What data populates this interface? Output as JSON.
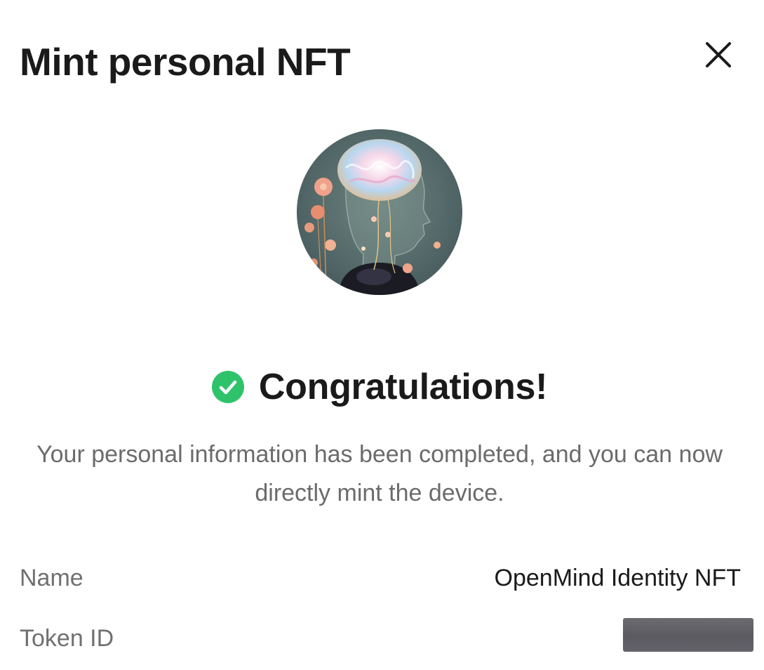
{
  "modal": {
    "title": "Mint personal NFT"
  },
  "icons": {
    "close": "close-icon",
    "success": "check-circle-icon"
  },
  "colors": {
    "success": "#2ec36b",
    "title_text": "#1a1a1a",
    "muted_text": "#6b6b6b",
    "redaction": "#5f5f65"
  },
  "status": {
    "title": "Congratulations!",
    "message": "Your personal information has been completed, and you can now directly mint the device."
  },
  "details": {
    "name_label": "Name",
    "name_value": "OpenMind Identity NFT",
    "token_label": "Token ID"
  }
}
